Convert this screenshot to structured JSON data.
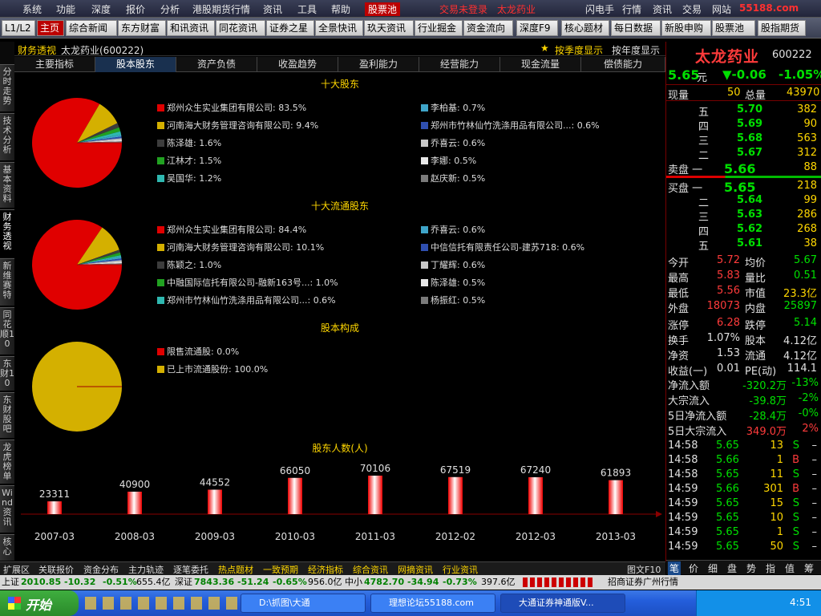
{
  "menu": {
    "items": [
      "系统",
      "功能",
      "深度",
      "报价",
      "分析",
      "港股期货行情",
      "资讯",
      "工具",
      "帮助",
      "股票池"
    ],
    "trade_status": "交易未登录",
    "stock_name": "太龙药业",
    "right_items": [
      "闪电手",
      "行情",
      "资讯",
      "交易",
      "网站"
    ],
    "watermark": "55188.com"
  },
  "toolbar": {
    "buttons": [
      "L1/L2",
      "主页",
      "综合新闻",
      "东方财富",
      "和讯资讯",
      "同花资讯",
      "证券之星",
      "全景快讯",
      "玖天资讯",
      "行业掘金",
      "资金流向",
      "深度F9",
      "核心题材",
      "每日数据",
      "新股申购",
      "股票池",
      "股指期货"
    ]
  },
  "vtabs": [
    "分时走势",
    "技术分析",
    "基本资料",
    "财务透视",
    "新维赛特",
    "同花顺10",
    "东财10",
    "东财股吧",
    "龙虎榜单",
    "Wind资讯",
    "核心"
  ],
  "finance": {
    "header_title": "财务透视",
    "header_stock": "太龙药业(600222)",
    "by_quarter": "按季度显示",
    "by_year": "按年度显示",
    "star": "★"
  },
  "subtabs": [
    "主要指标",
    "股本股东",
    "资产负债",
    "收盈趋势",
    "盈利能力",
    "经营能力",
    "现金流量",
    "偿债能力"
  ],
  "sections": {
    "top10": "十大股东",
    "top10_float": "十大流通股东",
    "structure": "股本构成",
    "holders": "股东人数(人)"
  },
  "top10": [
    {
      "label": "郑州众生实业集团有限公司: 83.5%",
      "value": 83.5,
      "color": "#e00000"
    },
    {
      "label": "河南海大财务管理咨询有限公司: 9.4%",
      "value": 9.4,
      "color": "#d4b000"
    },
    {
      "label": "陈泽雄: 1.6%",
      "value": 1.6,
      "color": "#3c3c3c"
    },
    {
      "label": "江林才: 1.5%",
      "value": 1.5,
      "color": "#21a121"
    },
    {
      "label": "吴国华: 1.2%",
      "value": 1.2,
      "color": "#2fb8b0"
    },
    {
      "label": "李柏基: 0.7%",
      "value": 0.7,
      "color": "#3fa5c9"
    },
    {
      "label": "郑州市竹林仙竹洗涤用品有限公司...: 0.6%",
      "value": 0.6,
      "color": "#2f4fb0"
    },
    {
      "label": "乔喜云: 0.6%",
      "value": 0.6,
      "color": "#c9c9c9"
    },
    {
      "label": "李娜: 0.5%",
      "value": 0.5,
      "color": "#e8e8e8"
    },
    {
      "label": "赵庆新: 0.5%",
      "value": 0.5,
      "color": "#7a7a7a"
    }
  ],
  "top10_float": [
    {
      "label": "郑州众生实业集团有限公司: 84.4%",
      "value": 84.4,
      "color": "#e00000"
    },
    {
      "label": "河南海大财务管理咨询有限公司: 10.1%",
      "value": 10.1,
      "color": "#d4b000"
    },
    {
      "label": "陈颖之: 1.0%",
      "value": 1.0,
      "color": "#3c3c3c"
    },
    {
      "label": "中融国际信托有限公司-融新163号...: 1.0%",
      "value": 1.0,
      "color": "#21a121"
    },
    {
      "label": "郑州市竹林仙竹洗涤用品有限公司...: 0.6%",
      "value": 0.6,
      "color": "#2fb8b0"
    },
    {
      "label": "乔喜云: 0.6%",
      "value": 0.6,
      "color": "#3fa5c9"
    },
    {
      "label": "中信信托有限责任公司-建苏718: 0.6%",
      "value": 0.6,
      "color": "#2f4fb0"
    },
    {
      "label": "丁耀辉: 0.6%",
      "value": 0.6,
      "color": "#c9c9c9"
    },
    {
      "label": "陈泽雄: 0.5%",
      "value": 0.5,
      "color": "#e8e8e8"
    },
    {
      "label": "杨振红: 0.5%",
      "value": 0.5,
      "color": "#7a7a7a"
    }
  ],
  "structure": [
    {
      "label": "限售流通股: 0.0%",
      "value": 0.0,
      "color": "#e00000"
    },
    {
      "label": "已上市流通股份: 100.0%",
      "value": 100.0,
      "color": "#d4b000"
    }
  ],
  "chart_data": {
    "type": "bar",
    "categories": [
      "2007-03",
      "2008-03",
      "2009-03",
      "2010-03",
      "2011-03",
      "2012-02",
      "2012-03",
      "2013-03"
    ],
    "values": [
      23311,
      40900,
      44552,
      66050,
      70106,
      67519,
      67240,
      61893
    ],
    "title": "股东人数(人)",
    "ylim": [
      0,
      100000
    ]
  },
  "quote": {
    "name": "太龙药业",
    "code": "600222",
    "price": "5.65",
    "unit": "元",
    "change": "▼-0.06",
    "pct": "-1.05%",
    "now_label": "现量",
    "now_val": "50",
    "total_label": "总量",
    "total_val": "43970",
    "sell": [
      {
        "l": "五",
        "p": "5.70",
        "v": "382"
      },
      {
        "l": "四",
        "p": "5.69",
        "v": "90"
      },
      {
        "l": "三",
        "p": "5.68",
        "v": "563"
      },
      {
        "l": "二",
        "p": "5.67",
        "v": "312"
      },
      {
        "l": "卖盘 一",
        "p": "5.66",
        "v": "88"
      }
    ],
    "buy": [
      {
        "l": "买盘 一",
        "p": "5.65",
        "v": "218"
      },
      {
        "l": "二",
        "p": "5.64",
        "v": "99"
      },
      {
        "l": "三",
        "p": "5.63",
        "v": "286"
      },
      {
        "l": "四",
        "p": "5.62",
        "v": "268"
      },
      {
        "l": "五",
        "p": "5.61",
        "v": "38"
      }
    ],
    "stats": [
      [
        "今开",
        "5.72",
        "均价",
        "5.67"
      ],
      [
        "最高",
        "5.83",
        "量比",
        "0.51"
      ],
      [
        "最低",
        "5.56",
        "市值",
        "23.3亿"
      ],
      [
        "外盘",
        "18073",
        "内盘",
        "25897"
      ]
    ],
    "stats2": [
      [
        "涨停",
        "6.28",
        "跌停",
        "5.14"
      ],
      [
        "换手",
        "1.07%",
        "股本",
        "4.12亿"
      ],
      [
        "净资",
        "1.53",
        "流通",
        "4.12亿"
      ],
      [
        "收益(一)",
        "0.01",
        "PE(动)",
        "114.1"
      ]
    ],
    "flows": [
      [
        "净流入额",
        "-320.2万",
        "-13%"
      ],
      [
        "大宗流入",
        "-39.8万",
        "-2%"
      ],
      [
        "5日净流入额",
        "-28.4万",
        "-0%"
      ],
      [
        "5日大宗流入",
        "349.0万",
        "2%"
      ]
    ],
    "ticks": [
      [
        "14:58",
        "5.65",
        "13",
        "S"
      ],
      [
        "14:58",
        "5.66",
        "1",
        "B"
      ],
      [
        "14:58",
        "5.65",
        "11",
        "S"
      ],
      [
        "14:59",
        "5.66",
        "301",
        "B"
      ],
      [
        "14:59",
        "5.65",
        "15",
        "S"
      ],
      [
        "14:59",
        "5.65",
        "10",
        "S"
      ],
      [
        "14:59",
        "5.65",
        "1",
        "S"
      ],
      [
        "14:59",
        "5.65",
        "50",
        "S"
      ]
    ],
    "tick_dash": "–",
    "tabs": [
      "笔",
      "价",
      "细",
      "盘",
      "势",
      "指",
      "值",
      "筹"
    ]
  },
  "bottom_tabs": [
    "扩展区",
    "关联报价",
    "资金分布",
    "主力轨迹",
    "逐笔委托",
    "热点题材",
    "一致预期",
    "经济指标",
    "综合资讯",
    "网摘资讯",
    "行业资讯"
  ],
  "bottom_right": "图文F10",
  "index_bar": {
    "sh_label": "上证",
    "sh": "2010.85",
    "sh_chg": "-10.32",
    "sh_pct": "-0.51%",
    "sh_amt": "655.4亿",
    "sz_label": "深证",
    "sz": "7843.36",
    "sz_chg": "-51.24",
    "sz_pct": "-0.65%",
    "sz_amt": "956.0亿",
    "zx_label": "中小",
    "zx": "4782.70",
    "zx_chg": "-34.94",
    "zx_pct": "-0.73%",
    "zx_amt": "397.6亿",
    "broker": "招商证券广州行情"
  },
  "taskbar": {
    "start": "开始",
    "tasks": [
      "D:\\抓图\\大通",
      "理想论坛55188.com",
      "大通证券神通版V..."
    ],
    "clock": "4:51"
  }
}
